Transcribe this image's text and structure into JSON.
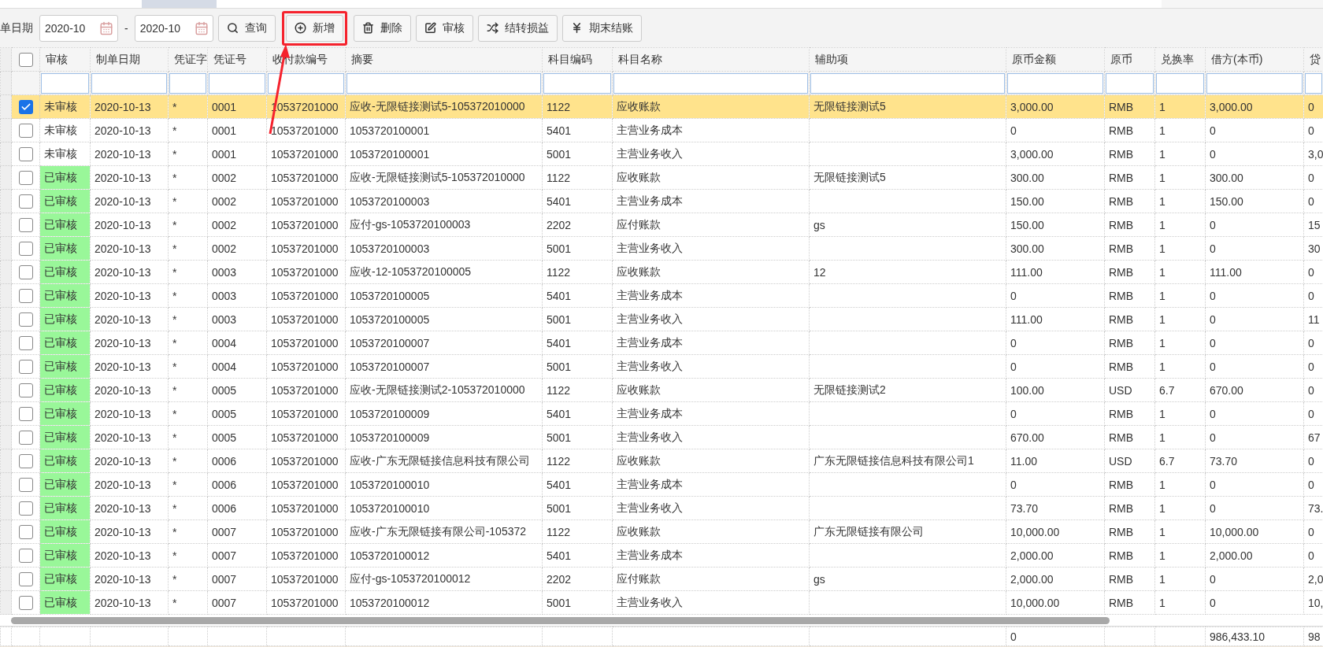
{
  "toolbar": {
    "date_label": "单日期",
    "date_from": "2020-10",
    "range_separator": "-",
    "date_to": "2020-10",
    "buttons": [
      {
        "label": "查询",
        "highlighted": false
      },
      {
        "label": "新增",
        "highlighted": true
      },
      {
        "label": "删除",
        "highlighted": false
      },
      {
        "label": "审核",
        "highlighted": false
      },
      {
        "label": "结转损益",
        "highlighted": false
      },
      {
        "label": "期末结账",
        "highlighted": false
      }
    ]
  },
  "table": {
    "select_all_checked": false,
    "columns": [
      "审核",
      "制单日期",
      "凭证字",
      "凭证号",
      "收付款编号",
      "摘要",
      "科目编码",
      "科目名称",
      "辅助项",
      "原币金额",
      "原币",
      "兑换率",
      "借方(本币)",
      "贷"
    ],
    "rows": [
      {
        "selected": true,
        "audited": false,
        "status": "未审核",
        "date": "2020-10-13",
        "voucher_word": "*",
        "voucher_no": "0001",
        "payment_no": "10537201000",
        "summary": "应收-无限链接测试5-105372010000",
        "account_code": "1122",
        "account_name": "应收账款",
        "auxiliary": "无限链接测试5",
        "amount": "3,000.00",
        "currency": "RMB",
        "rate": "1",
        "debit": "3,000.00",
        "credit": "0"
      },
      {
        "selected": false,
        "audited": false,
        "status": "未审核",
        "date": "2020-10-13",
        "voucher_word": "*",
        "voucher_no": "0001",
        "payment_no": "10537201000",
        "summary": "1053720100001",
        "account_code": "5401",
        "account_name": "主营业务成本",
        "amount": "0",
        "currency": "RMB",
        "rate": "1",
        "debit": "0",
        "credit": "0"
      },
      {
        "selected": false,
        "audited": false,
        "status": "未审核",
        "date": "2020-10-13",
        "voucher_word": "*",
        "voucher_no": "0001",
        "payment_no": "10537201000",
        "summary": "1053720100001",
        "account_code": "5001",
        "account_name": "主营业务收入",
        "amount": "3,000.00",
        "currency": "RMB",
        "rate": "1",
        "debit": "0",
        "credit": "3,0"
      },
      {
        "selected": false,
        "audited": true,
        "status": "已审核",
        "date": "2020-10-13",
        "voucher_word": "*",
        "voucher_no": "0002",
        "payment_no": "10537201000",
        "summary": "应收-无限链接测试5-105372010000",
        "account_code": "1122",
        "account_name": "应收账款",
        "auxiliary": "无限链接测试5",
        "amount": "300.00",
        "currency": "RMB",
        "rate": "1",
        "debit": "300.00",
        "credit": "0"
      },
      {
        "selected": false,
        "audited": true,
        "status": "已审核",
        "date": "2020-10-13",
        "voucher_word": "*",
        "voucher_no": "0002",
        "payment_no": "10537201000",
        "summary": "1053720100003",
        "account_code": "5401",
        "account_name": "主营业务成本",
        "amount": "150.00",
        "currency": "RMB",
        "rate": "1",
        "debit": "150.00",
        "credit": "0"
      },
      {
        "selected": false,
        "audited": true,
        "status": "已审核",
        "date": "2020-10-13",
        "voucher_word": "*",
        "voucher_no": "0002",
        "payment_no": "10537201000",
        "summary": "应付-gs-1053720100003",
        "account_code": "2202",
        "account_name": "应付账款",
        "auxiliary": "gs",
        "amount": "150.00",
        "currency": "RMB",
        "rate": "1",
        "debit": "0",
        "credit": "15"
      },
      {
        "selected": false,
        "audited": true,
        "status": "已审核",
        "date": "2020-10-13",
        "voucher_word": "*",
        "voucher_no": "0002",
        "payment_no": "10537201000",
        "summary": "1053720100003",
        "account_code": "5001",
        "account_name": "主营业务收入",
        "amount": "300.00",
        "currency": "RMB",
        "rate": "1",
        "debit": "0",
        "credit": "30"
      },
      {
        "selected": false,
        "audited": true,
        "status": "已审核",
        "date": "2020-10-13",
        "voucher_word": "*",
        "voucher_no": "0003",
        "payment_no": "10537201000",
        "summary": "应收-12-1053720100005",
        "account_code": "1122",
        "account_name": "应收账款",
        "auxiliary": "12",
        "amount": "111.00",
        "currency": "RMB",
        "rate": "1",
        "debit": "111.00",
        "credit": "0"
      },
      {
        "selected": false,
        "audited": true,
        "status": "已审核",
        "date": "2020-10-13",
        "voucher_word": "*",
        "voucher_no": "0003",
        "payment_no": "10537201000",
        "summary": "1053720100005",
        "account_code": "5401",
        "account_name": "主营业务成本",
        "amount": "0",
        "currency": "RMB",
        "rate": "1",
        "debit": "0",
        "credit": "0"
      },
      {
        "selected": false,
        "audited": true,
        "status": "已审核",
        "date": "2020-10-13",
        "voucher_word": "*",
        "voucher_no": "0003",
        "payment_no": "10537201000",
        "summary": "1053720100005",
        "account_code": "5001",
        "account_name": "主营业务收入",
        "amount": "111.00",
        "currency": "RMB",
        "rate": "1",
        "debit": "0",
        "credit": "11"
      },
      {
        "selected": false,
        "audited": true,
        "status": "已审核",
        "date": "2020-10-13",
        "voucher_word": "*",
        "voucher_no": "0004",
        "payment_no": "10537201000",
        "summary": "1053720100007",
        "account_code": "5401",
        "account_name": "主营业务成本",
        "amount": "0",
        "currency": "RMB",
        "rate": "1",
        "debit": "0",
        "credit": "0"
      },
      {
        "selected": false,
        "audited": true,
        "status": "已审核",
        "date": "2020-10-13",
        "voucher_word": "*",
        "voucher_no": "0004",
        "payment_no": "10537201000",
        "summary": "1053720100007",
        "account_code": "5001",
        "account_name": "主营业务收入",
        "amount": "0",
        "currency": "RMB",
        "rate": "1",
        "debit": "0",
        "credit": "0"
      },
      {
        "selected": false,
        "audited": true,
        "status": "已审核",
        "date": "2020-10-13",
        "voucher_word": "*",
        "voucher_no": "0005",
        "payment_no": "10537201000",
        "summary": "应收-无限链接测试2-105372010000",
        "account_code": "1122",
        "account_name": "应收账款",
        "auxiliary": "无限链接测试2",
        "amount": "100.00",
        "currency": "USD",
        "rate": "6.7",
        "debit": "670.00",
        "credit": "0"
      },
      {
        "selected": false,
        "audited": true,
        "status": "已审核",
        "date": "2020-10-13",
        "voucher_word": "*",
        "voucher_no": "0005",
        "payment_no": "10537201000",
        "summary": "1053720100009",
        "account_code": "5401",
        "account_name": "主营业务成本",
        "amount": "0",
        "currency": "RMB",
        "rate": "1",
        "debit": "0",
        "credit": "0"
      },
      {
        "selected": false,
        "audited": true,
        "status": "已审核",
        "date": "2020-10-13",
        "voucher_word": "*",
        "voucher_no": "0005",
        "payment_no": "10537201000",
        "summary": "1053720100009",
        "account_code": "5001",
        "account_name": "主营业务收入",
        "amount": "670.00",
        "currency": "RMB",
        "rate": "1",
        "debit": "0",
        "credit": "67"
      },
      {
        "selected": false,
        "audited": true,
        "status": "已审核",
        "date": "2020-10-13",
        "voucher_word": "*",
        "voucher_no": "0006",
        "payment_no": "10537201000",
        "summary": "应收-广东无限链接信息科技有限公司",
        "account_code": "1122",
        "account_name": "应收账款",
        "auxiliary": "广东无限链接信息科技有限公司1",
        "amount": "11.00",
        "currency": "USD",
        "rate": "6.7",
        "debit": "73.70",
        "credit": "0"
      },
      {
        "selected": false,
        "audited": true,
        "status": "已审核",
        "date": "2020-10-13",
        "voucher_word": "*",
        "voucher_no": "0006",
        "payment_no": "10537201000",
        "summary": "1053720100010",
        "account_code": "5401",
        "account_name": "主营业务成本",
        "amount": "0",
        "currency": "RMB",
        "rate": "1",
        "debit": "0",
        "credit": "0"
      },
      {
        "selected": false,
        "audited": true,
        "status": "已审核",
        "date": "2020-10-13",
        "voucher_word": "*",
        "voucher_no": "0006",
        "payment_no": "10537201000",
        "summary": "1053720100010",
        "account_code": "5001",
        "account_name": "主营业务收入",
        "amount": "73.70",
        "currency": "RMB",
        "rate": "1",
        "debit": "0",
        "credit": "73."
      },
      {
        "selected": false,
        "audited": true,
        "status": "已审核",
        "date": "2020-10-13",
        "voucher_word": "*",
        "voucher_no": "0007",
        "payment_no": "10537201000",
        "summary": "应收-广东无限链接有限公司-105372",
        "account_code": "1122",
        "account_name": "应收账款",
        "auxiliary": "广东无限链接有限公司",
        "amount": "10,000.00",
        "currency": "RMB",
        "rate": "1",
        "debit": "10,000.00",
        "credit": "0"
      },
      {
        "selected": false,
        "audited": true,
        "status": "已审核",
        "date": "2020-10-13",
        "voucher_word": "*",
        "voucher_no": "0007",
        "payment_no": "10537201000",
        "summary": "1053720100012",
        "account_code": "5401",
        "account_name": "主营业务成本",
        "amount": "2,000.00",
        "currency": "RMB",
        "rate": "1",
        "debit": "2,000.00",
        "credit": "0"
      },
      {
        "selected": false,
        "audited": true,
        "status": "已审核",
        "date": "2020-10-13",
        "voucher_word": "*",
        "voucher_no": "0007",
        "payment_no": "10537201000",
        "summary": "应付-gs-1053720100012",
        "account_code": "2202",
        "account_name": "应付账款",
        "auxiliary": "gs",
        "amount": "2,000.00",
        "currency": "RMB",
        "rate": "1",
        "debit": "0",
        "credit": "2,0"
      },
      {
        "selected": false,
        "audited": true,
        "status": "已审核",
        "date": "2020-10-13",
        "voucher_word": "*",
        "voucher_no": "0007",
        "payment_no": "10537201000",
        "summary": "1053720100012",
        "account_code": "5001",
        "account_name": "主营业务收入",
        "amount": "10,000.00",
        "currency": "RMB",
        "rate": "1",
        "debit": "0",
        "credit": "10,"
      }
    ],
    "footer": {
      "amount": "0",
      "debit": "986,433.10",
      "credit": "98"
    }
  }
}
